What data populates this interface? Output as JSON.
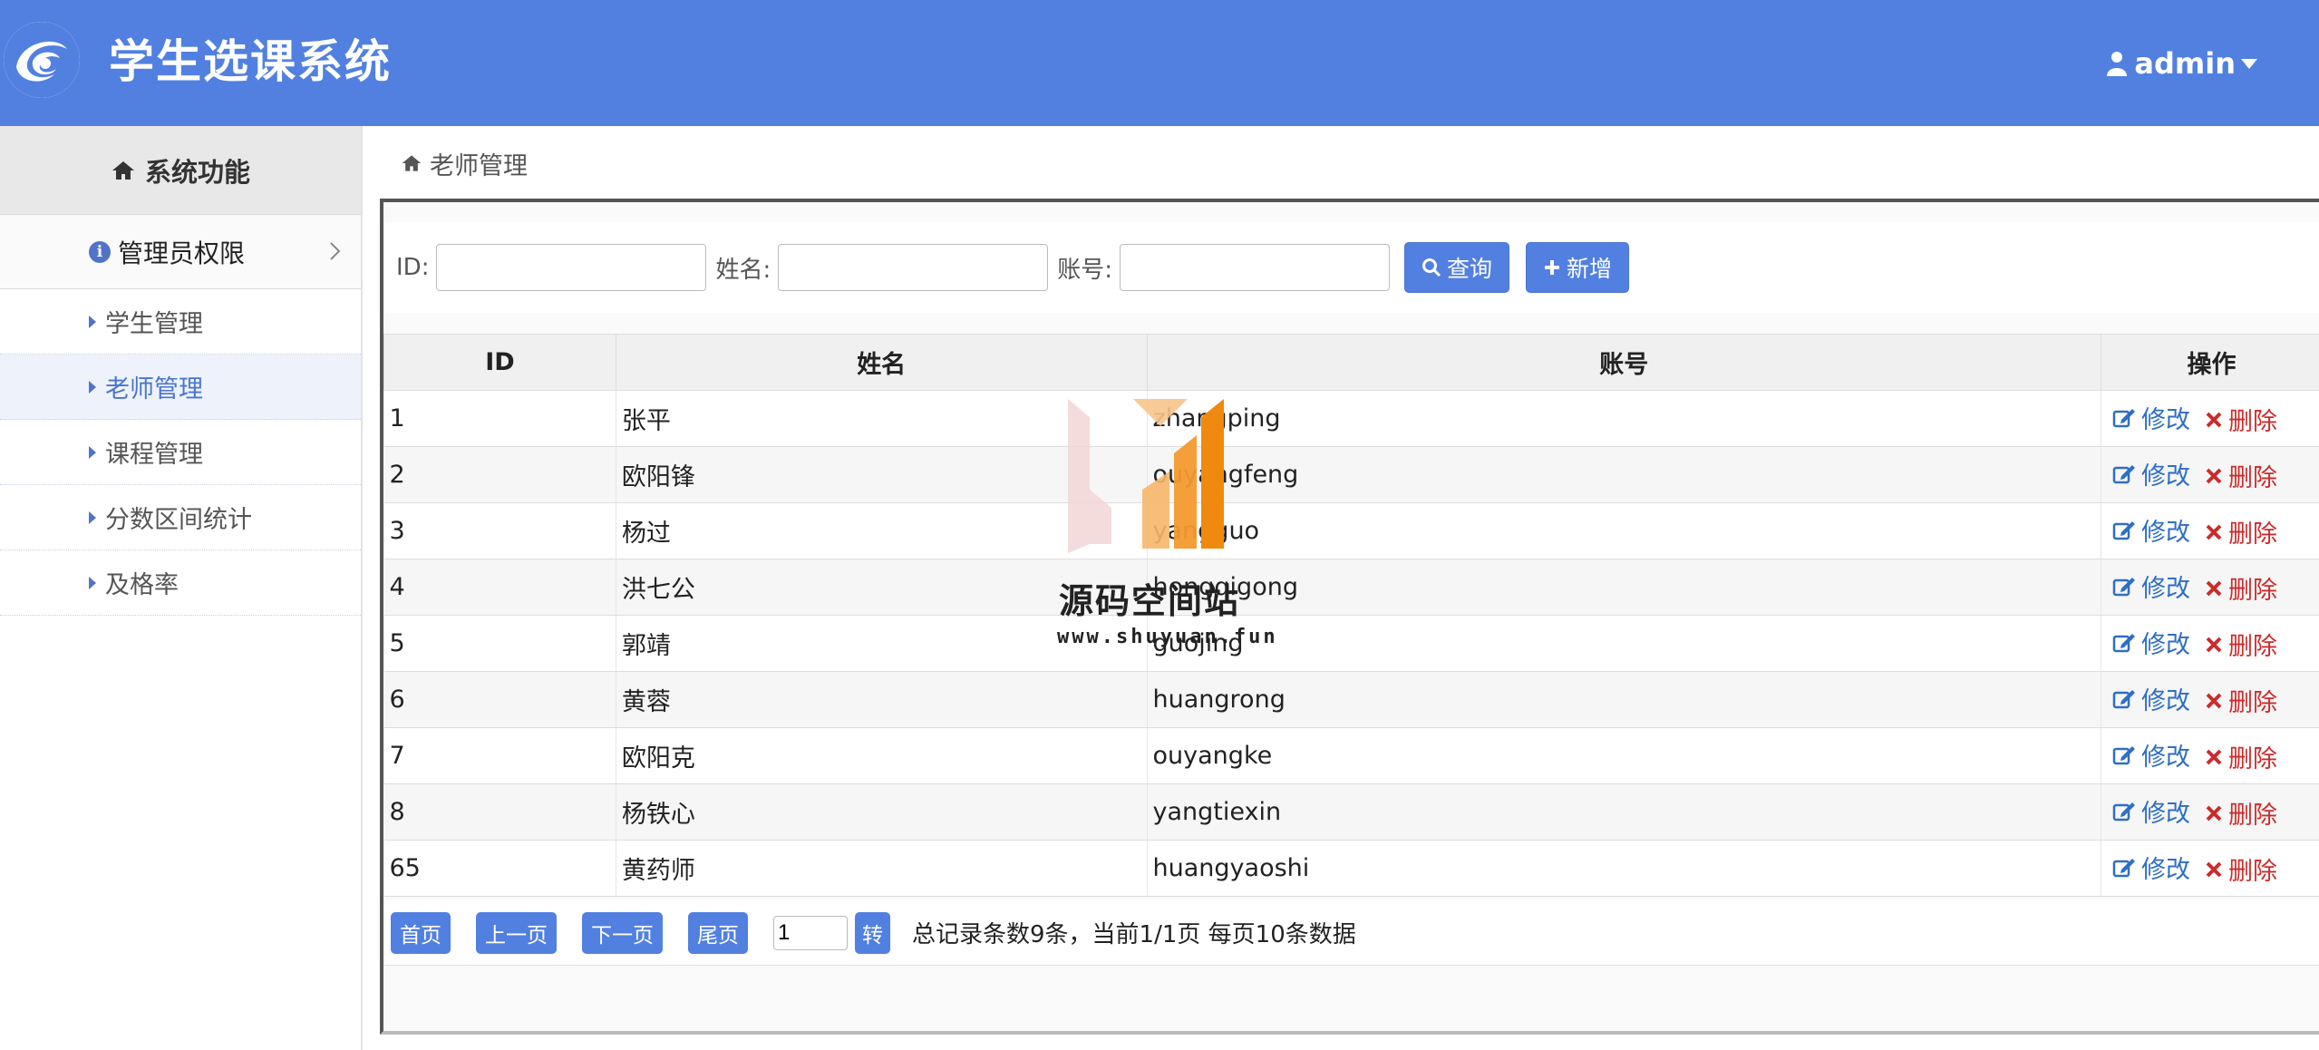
{
  "header": {
    "title": "学生选课系统",
    "user": "admin",
    "brand_color": "#5280e0"
  },
  "sidebar": {
    "heading": "系统功能",
    "group": "管理员权限",
    "items": [
      {
        "label": "学生管理",
        "active": false
      },
      {
        "label": "老师管理",
        "active": true
      },
      {
        "label": "课程管理",
        "active": false
      },
      {
        "label": "分数区间统计",
        "active": false
      },
      {
        "label": "及格率",
        "active": false
      }
    ]
  },
  "breadcrumb": "老师管理",
  "search": {
    "id_label": "ID:",
    "name_label": "姓名:",
    "account_label": "账号:",
    "id_value": "",
    "name_value": "",
    "account_value": "",
    "search_button": "查询",
    "add_button": "新增"
  },
  "table": {
    "columns": [
      "ID",
      "姓名",
      "账号",
      "操作"
    ],
    "edit_label": "修改",
    "delete_label": "删除",
    "rows": [
      {
        "id": "1",
        "name": "张平",
        "account": "zhangping"
      },
      {
        "id": "2",
        "name": "欧阳锋",
        "account": "ouyangfeng"
      },
      {
        "id": "3",
        "name": "杨过",
        "account": "yangguo"
      },
      {
        "id": "4",
        "name": "洪七公",
        "account": "hongqigong"
      },
      {
        "id": "5",
        "name": "郭靖",
        "account": "guojing"
      },
      {
        "id": "6",
        "name": "黄蓉",
        "account": "huangrong"
      },
      {
        "id": "7",
        "name": "欧阳克",
        "account": "ouyangke"
      },
      {
        "id": "8",
        "name": "杨铁心",
        "account": "yangtiexin"
      },
      {
        "id": "65",
        "name": "黄药师",
        "account": "huangyaoshi"
      }
    ]
  },
  "pager": {
    "first": "首页",
    "prev": "上一页",
    "next": "下一页",
    "last": "尾页",
    "page_value": "1",
    "go": "转",
    "info": "总记录条数9条，当前1/1页 每页10条数据"
  },
  "watermark": {
    "name": "源码空间站",
    "url": "www.shuyuan.fun"
  }
}
